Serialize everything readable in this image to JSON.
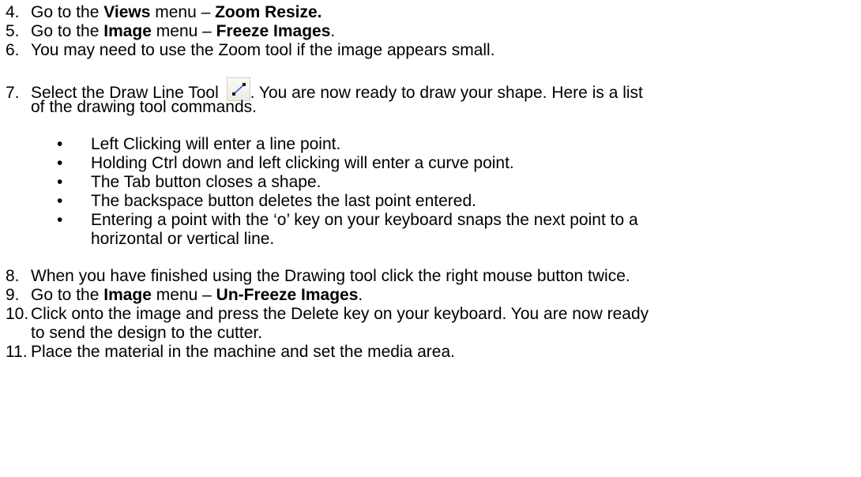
{
  "steps": {
    "s4": {
      "num": "4.",
      "pre": "Go to the ",
      "menu": "Views",
      "mid": " menu – ",
      "cmd": "Zoom Resize."
    },
    "s5": {
      "num": "5.",
      "pre": "Go to the ",
      "menu": "Image",
      "mid": " menu – ",
      "cmd": "Freeze Images",
      "post": "."
    },
    "s6": {
      "num": "6.",
      "text": "You may need to use the Zoom tool if the image appears small."
    },
    "s7": {
      "num": "7.",
      "pre": "Select the Draw Line Tool ",
      "post": ". You are now ready to draw your shape. Here is a list",
      "cont": "of the drawing tool commands.",
      "icon": "draw-line-icon"
    },
    "bullets": [
      {
        "marker": "•",
        "text": "Left Clicking will enter a line point."
      },
      {
        "marker": "•",
        "text": "Holding Ctrl down and left clicking will enter a curve point."
      },
      {
        "marker": "•",
        "text": "The Tab button closes a shape."
      },
      {
        "marker": "•",
        "text": "The backspace button deletes the last point entered."
      },
      {
        "marker": "•",
        "text": "Entering a point with the ‘o’ key on your keyboard snaps the next point to a",
        "cont": "horizontal or vertical line."
      }
    ],
    "s8": {
      "num": "8.",
      "text": "When you have finished using the Drawing tool click the right mouse button twice."
    },
    "s9": {
      "num": "9.",
      "pre": "Go to the ",
      "menu": "Image",
      "mid": " menu – ",
      "cmd": "Un-Freeze Images",
      "post": "."
    },
    "s10": {
      "num": "10.",
      "text": "Click onto the image and press the Delete key on your keyboard. You are now ready",
      "cont": "to send the design to the cutter."
    },
    "s11": {
      "num": "11.",
      "text": "Place the material in the machine and set the media area."
    }
  }
}
